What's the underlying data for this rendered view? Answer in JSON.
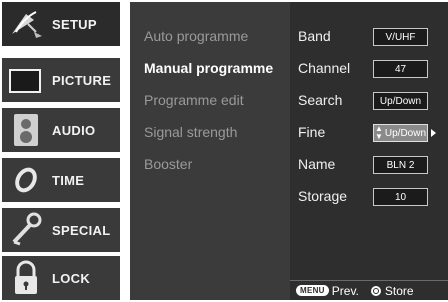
{
  "main_menu": {
    "items": [
      {
        "label": "SETUP",
        "icon": "satellite-dish-icon"
      },
      {
        "label": "PICTURE",
        "icon": "tv-screen-icon"
      },
      {
        "label": "AUDIO",
        "icon": "speaker-icon"
      },
      {
        "label": "TIME",
        "icon": "clock-icon"
      },
      {
        "label": "SPECIAL",
        "icon": "special-feature-icon"
      },
      {
        "label": "LOCK",
        "icon": "padlock-icon"
      }
    ],
    "selected": "SETUP"
  },
  "sub_menu": {
    "items": [
      {
        "label": "Auto programme"
      },
      {
        "label": "Manual programme"
      },
      {
        "label": "Programme edit"
      },
      {
        "label": "Signal strength"
      },
      {
        "label": "Booster"
      }
    ],
    "selected": "Manual programme"
  },
  "settings": {
    "rows": [
      {
        "label": "Band",
        "value": "V/UHF"
      },
      {
        "label": "Channel",
        "value": "47"
      },
      {
        "label": "Search",
        "value": "Up/Down"
      },
      {
        "label": "Fine",
        "value": "Up/Down"
      },
      {
        "label": "Name",
        "value": "BLN 2"
      },
      {
        "label": "Storage",
        "value": "10"
      }
    ],
    "focused_row": "Fine"
  },
  "hints": {
    "menu_key": "MENU",
    "prev_label": "Prev.",
    "store_label": "Store"
  },
  "colors": {
    "menu_bg": "#3a3a3a",
    "submenu_bg": "#3b3b3b",
    "settings_bg": "#2e2e2e",
    "value_box_bg": "#1b1b1b",
    "focused_value_bg": "#8a8a8a",
    "inactive_text": "#9a9a9a",
    "active_text": "#ffffff"
  }
}
